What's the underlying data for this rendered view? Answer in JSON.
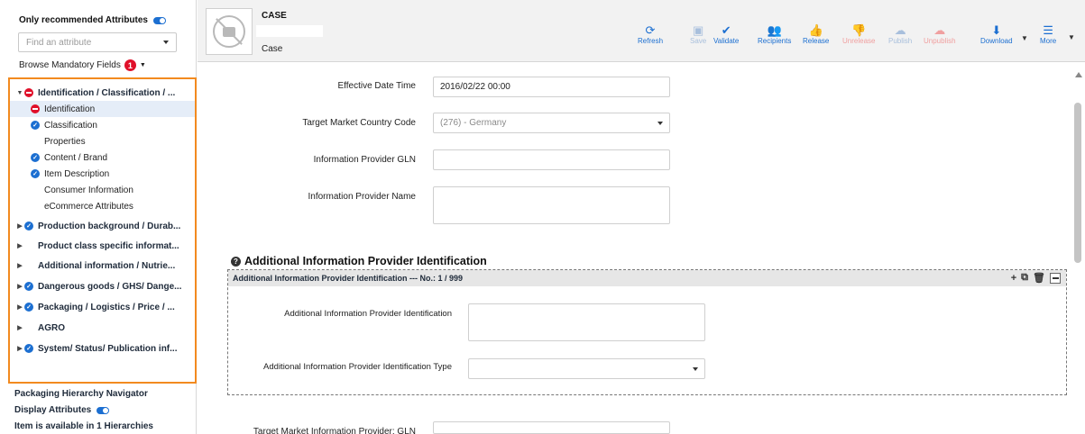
{
  "sidebar": {
    "recommended_label": "Only recommended Attributes",
    "find_placeholder": "Find an attribute",
    "browse_label": "Browse Mandatory Fields",
    "browse_count": "1",
    "tree": [
      {
        "label": "Identification / Classification / ...",
        "status": "error",
        "expanded": true
      },
      {
        "label": "Identification",
        "status": "error",
        "selected": true
      },
      {
        "label": "Classification",
        "status": "ok"
      },
      {
        "label": "Properties",
        "status": "none"
      },
      {
        "label": "Content / Brand",
        "status": "ok"
      },
      {
        "label": "Item Description",
        "status": "ok"
      },
      {
        "label": "Consumer Information",
        "status": "none"
      },
      {
        "label": "eCommerce Attributes",
        "status": "none"
      },
      {
        "label": "Production background / Durab...",
        "status": "ok"
      },
      {
        "label": "Product class specific informat...",
        "status": "none"
      },
      {
        "label": "Additional information / Nutrie...",
        "status": "none"
      },
      {
        "label": "Dangerous goods / GHS/ Dange...",
        "status": "ok"
      },
      {
        "label": "Packaging / Logistics / Price / ...",
        "status": "ok"
      },
      {
        "label": "AGRO",
        "status": "none"
      },
      {
        "label": "System/ Status/ Publication inf...",
        "status": "ok"
      }
    ],
    "packaging_nav": "Packaging Hierarchy Navigator",
    "display_attributes": "Display Attributes",
    "hierarchies": "Item is available in 1 Hierarchies"
  },
  "header": {
    "type": "CASE",
    "subtitle": "Case",
    "toolbar": {
      "refresh": "Refresh",
      "save": "Save",
      "validate": "Validate",
      "recipients": "Recipients",
      "release": "Release",
      "unrelease": "Unrelease",
      "publish": "Publish",
      "unpublish": "Unpublish",
      "download": "Download",
      "more": "More"
    }
  },
  "form": {
    "effective_label": "Effective Date Time",
    "effective_value": "2016/02/22 00:00",
    "country_label": "Target Market Country Code",
    "country_value": "(276) - Germany",
    "gln_label": "Information Provider GLN",
    "gln_value": "",
    "name_label": "Information Provider Name",
    "section_title": "Additional Information Provider Identification",
    "group_header": "Additional Information Provider Identification --- No.: 1 / 999",
    "add_id_label": "Additional Information Provider Identification",
    "add_type_label": "Additional Information Provider Identification Type",
    "tm_gln_label": "Target Market Information Provider: GLN"
  },
  "colors": {
    "accent": "#1c6fd1",
    "error": "#e0102a",
    "highlight_border": "#f28a1f",
    "disabled": "#f0a0a0"
  }
}
